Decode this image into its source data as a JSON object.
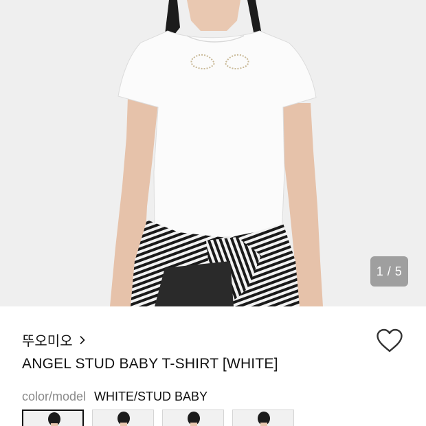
{
  "gallery": {
    "counter": "1 / 5",
    "current": 1,
    "total": 5
  },
  "product": {
    "brand": "뚜오미오",
    "title": "ANGEL STUD BABY T-SHIRT [WHITE]",
    "color_label": "color/model",
    "color_value": "WHITE/STUD BABY"
  },
  "icons": {
    "brand_link": "chevron-right-icon",
    "wishlist": "heart-outline-icon"
  },
  "thumbnails": {
    "count": 4,
    "selected_index": 0
  },
  "colors": {
    "background": "#efefef",
    "counter_bg": "#6e6e6e",
    "text_primary": "#111111",
    "text_secondary": "#8a8a8a"
  }
}
